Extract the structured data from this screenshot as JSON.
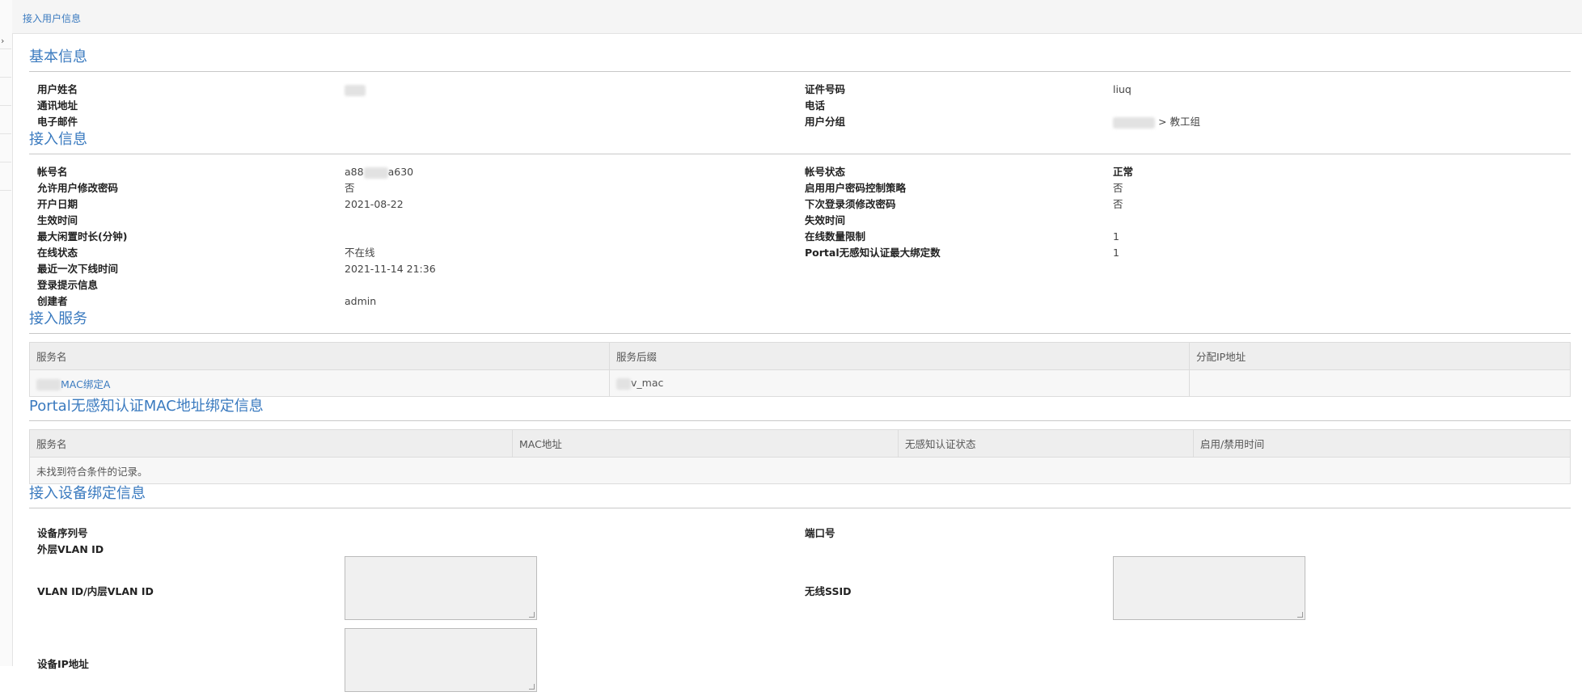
{
  "breadcrumb": "接入用户信息",
  "sections": {
    "basic": "基本信息",
    "access": "接入信息",
    "service": "接入服务",
    "portal": "Portal无感知认证MAC地址绑定信息",
    "device": "接入设备绑定信息"
  },
  "basic": {
    "name_label": "用户姓名",
    "id_label": "证件号码",
    "id_value": "liuq",
    "addr_label": "通讯地址",
    "phone_label": "电话",
    "email_label": "电子邮件",
    "group_label": "用户分组",
    "group_value": "> 教工组"
  },
  "access": {
    "account_label": "帐号名",
    "account_value_a": "a88",
    "account_value_b": "a630",
    "status_label": "帐号状态",
    "status_value": "正常",
    "allow_change_label": "允许用户修改密码",
    "allow_change_value": "否",
    "pwd_policy_label": "启用用户密码控制策略",
    "pwd_policy_value": "否",
    "open_date_label": "开户日期",
    "open_date_value": "2021-08-22",
    "next_login_label": "下次登录须修改密码",
    "next_login_value": "否",
    "effective_label": "生效时间",
    "expire_label": "失效时间",
    "idle_label": "最大闲置时长(分钟)",
    "online_limit_label": "在线数量限制",
    "online_limit_value": "1",
    "online_status_label": "在线状态",
    "online_status_value": "不在线",
    "portal_max_label": "Portal无感知认证最大绑定数",
    "portal_max_value": "1",
    "last_offline_label": "最近一次下线时间",
    "last_offline_value": "2021-11-14 21:36",
    "login_tip_label": "登录提示信息",
    "creator_label": "创建者",
    "creator_value": "admin"
  },
  "service_table": {
    "headers": [
      "服务名",
      "服务后缀",
      "分配IP地址"
    ],
    "rows": [
      [
        "MAC绑定A",
        "v_mac",
        ""
      ]
    ]
  },
  "portal_table": {
    "headers": [
      "服务名",
      "MAC地址",
      "无感知认证状态",
      "启用/禁用时间"
    ],
    "empty": "未找到符合条件的记录。"
  },
  "device": {
    "serial_label": "设备序列号",
    "port_label": "端口号",
    "outer_vlan_label": "外层VLAN ID",
    "vlan_label": "VLAN ID/内层VLAN ID",
    "ssid_label": "无线SSID",
    "ip_label": "设备IP地址"
  }
}
